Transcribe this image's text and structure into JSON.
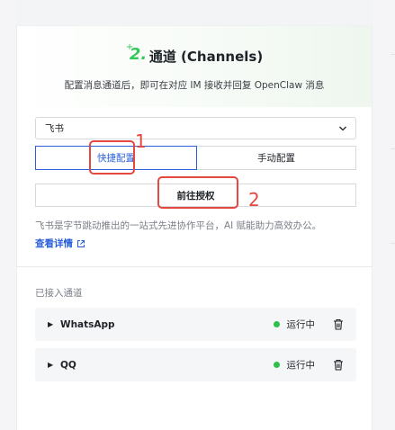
{
  "panel": {
    "step_number": "2.",
    "title": "通道 (Channels)",
    "subtitle": "配置消息通道后，即可在对应 IM 接收并回复 OpenClaw 消息"
  },
  "channel_select": {
    "selected": "飞书"
  },
  "mode_tabs": {
    "quick": "快捷配置",
    "manual": "手动配置",
    "active": "quick"
  },
  "authorize_button": "前往授权",
  "description": "飞书是字节跳动推出的一站式先进协作平台，AI 赋能助力高效办公。",
  "details_link": "查看详情",
  "connected": {
    "label": "已接入通道",
    "channels": [
      {
        "name": "WhatsApp",
        "status": "运行中"
      },
      {
        "name": "QQ",
        "status": "运行中"
      }
    ]
  },
  "annotations": [
    "1",
    "2"
  ],
  "colors": {
    "accent_blue": "#2b5fd9",
    "running_green": "#2fbf4a",
    "step_green": "#34c759",
    "annotation_red": "#e5483f"
  }
}
